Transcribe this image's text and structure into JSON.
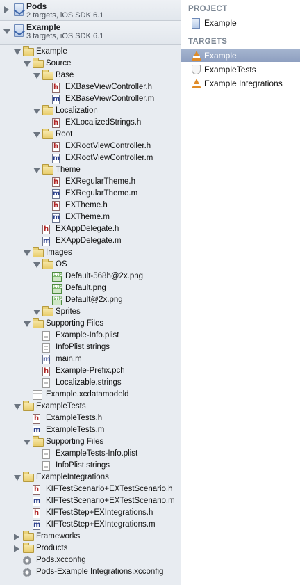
{
  "projects": [
    {
      "name": "Pods",
      "subtitle": "2 targets, iOS SDK 6.1",
      "expanded": false
    },
    {
      "name": "Example",
      "subtitle": "3 targets, iOS SDK 6.1",
      "expanded": true
    }
  ],
  "tree": [
    {
      "depth": 1,
      "type": "folder",
      "label": "Example",
      "disclosure": "open"
    },
    {
      "depth": 2,
      "type": "folder",
      "label": "Source",
      "disclosure": "open"
    },
    {
      "depth": 3,
      "type": "folder",
      "label": "Base",
      "disclosure": "open"
    },
    {
      "depth": 4,
      "type": "h",
      "label": "EXBaseViewController.h"
    },
    {
      "depth": 4,
      "type": "m",
      "label": "EXBaseViewController.m"
    },
    {
      "depth": 3,
      "type": "folder",
      "label": "Localization",
      "disclosure": "open"
    },
    {
      "depth": 4,
      "type": "h",
      "label": "EXLocalizedStrings.h"
    },
    {
      "depth": 3,
      "type": "folder",
      "label": "Root",
      "disclosure": "open"
    },
    {
      "depth": 4,
      "type": "h",
      "label": "EXRootViewController.h"
    },
    {
      "depth": 4,
      "type": "m",
      "label": "EXRootViewController.m"
    },
    {
      "depth": 3,
      "type": "folder",
      "label": "Theme",
      "disclosure": "open"
    },
    {
      "depth": 4,
      "type": "h",
      "label": "EXRegularTheme.h"
    },
    {
      "depth": 4,
      "type": "m",
      "label": "EXRegularTheme.m"
    },
    {
      "depth": 4,
      "type": "h",
      "label": "EXTheme.h"
    },
    {
      "depth": 4,
      "type": "m",
      "label": "EXTheme.m"
    },
    {
      "depth": 3,
      "type": "h",
      "label": "EXAppDelegate.h"
    },
    {
      "depth": 3,
      "type": "m",
      "label": "EXAppDelegate.m"
    },
    {
      "depth": 2,
      "type": "folder",
      "label": "Images",
      "disclosure": "open"
    },
    {
      "depth": 3,
      "type": "folder",
      "label": "OS",
      "disclosure": "open"
    },
    {
      "depth": 4,
      "type": "png",
      "label": "Default-568h@2x.png"
    },
    {
      "depth": 4,
      "type": "png",
      "label": "Default.png"
    },
    {
      "depth": 4,
      "type": "png",
      "label": "Default@2x.png"
    },
    {
      "depth": 3,
      "type": "folder",
      "label": "Sprites",
      "disclosure": "open"
    },
    {
      "depth": 2,
      "type": "folder",
      "label": "Supporting Files",
      "disclosure": "open"
    },
    {
      "depth": 3,
      "type": "plain",
      "label": "Example-Info.plist"
    },
    {
      "depth": 3,
      "type": "plain",
      "label": "InfoPlist.strings"
    },
    {
      "depth": 3,
      "type": "m",
      "label": "main.m"
    },
    {
      "depth": 3,
      "type": "h",
      "label": "Example-Prefix.pch"
    },
    {
      "depth": 3,
      "type": "plain",
      "label": "Localizable.strings"
    },
    {
      "depth": 2,
      "type": "datamodel",
      "label": "Example.xcdatamodeld"
    },
    {
      "depth": 1,
      "type": "folder",
      "label": "ExampleTests",
      "disclosure": "open"
    },
    {
      "depth": 2,
      "type": "h",
      "label": "ExampleTests.h"
    },
    {
      "depth": 2,
      "type": "m",
      "label": "ExampleTests.m"
    },
    {
      "depth": 2,
      "type": "folder",
      "label": "Supporting Files",
      "disclosure": "open"
    },
    {
      "depth": 3,
      "type": "plain",
      "label": "ExampleTests-Info.plist"
    },
    {
      "depth": 3,
      "type": "plain",
      "label": "InfoPlist.strings"
    },
    {
      "depth": 1,
      "type": "folder",
      "label": "ExampleIntegrations",
      "disclosure": "open"
    },
    {
      "depth": 2,
      "type": "h",
      "label": "KIFTestScenario+EXTestScenario.h"
    },
    {
      "depth": 2,
      "type": "m",
      "label": "KIFTestScenario+EXTestScenario.m"
    },
    {
      "depth": 2,
      "type": "h",
      "label": "KIFTestStep+EXIntegrations.h"
    },
    {
      "depth": 2,
      "type": "m",
      "label": "KIFTestStep+EXIntegrations.m"
    },
    {
      "depth": 1,
      "type": "folder",
      "label": "Frameworks",
      "disclosure": "closed"
    },
    {
      "depth": 1,
      "type": "folder",
      "label": "Products",
      "disclosure": "closed"
    },
    {
      "depth": 1,
      "type": "gear",
      "label": "Pods.xcconfig"
    },
    {
      "depth": 1,
      "type": "gear",
      "label": "Pods-Example Integrations.xcconfig"
    }
  ],
  "inspector": {
    "project_heading": "PROJECT",
    "project_item": "Example",
    "targets_heading": "TARGETS",
    "targets": [
      {
        "label": "Example",
        "icon": "app-target-icon",
        "selected": true
      },
      {
        "label": "ExampleTests",
        "icon": "test-target-icon",
        "selected": false
      },
      {
        "label": "Example Integrations",
        "icon": "app-target-icon",
        "selected": false
      }
    ]
  }
}
